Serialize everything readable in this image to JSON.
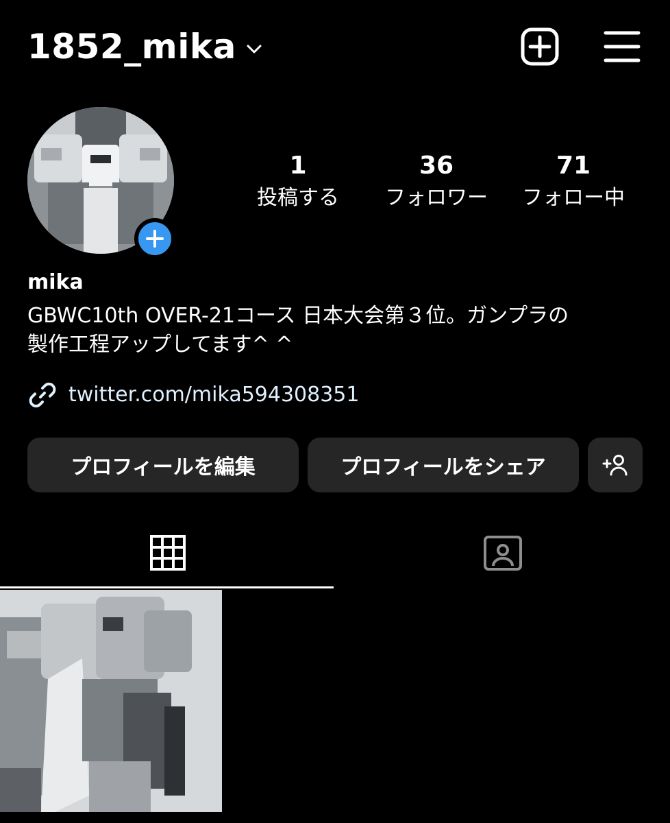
{
  "header": {
    "username": "1852_mika",
    "dropdown_icon": "chevron-down-icon",
    "new_post_icon": "plus-square-icon",
    "menu_icon": "hamburger-menu-icon"
  },
  "profile": {
    "avatar_icon": "profile-photo",
    "add_story_icon": "plus-icon",
    "stats": {
      "posts": {
        "value": "1",
        "label": "投稿する"
      },
      "followers": {
        "value": "36",
        "label": "フォロワー"
      },
      "following": {
        "value": "71",
        "label": "フォロー中"
      }
    },
    "name": "mika",
    "bio_lines": [
      "GBWC10th OVER-21コース 日本大会第３位。ガンプラの",
      "製作工程アップしてます^ ^"
    ],
    "link": {
      "icon": "link-icon",
      "text": "twitter.com/mika594308351"
    }
  },
  "actions": {
    "edit_label": "プロフィールを編集",
    "share_label": "プロフィールをシェア",
    "suggest_icon": "add-person-icon"
  },
  "tabs": [
    {
      "name": "grid",
      "icon": "grid-icon",
      "active": true
    },
    {
      "name": "tagged",
      "icon": "tagged-person-icon",
      "active": false
    }
  ],
  "posts": [
    {
      "icon": "post-photo"
    }
  ],
  "colors": {
    "background": "#000000",
    "button_bg": "#262626",
    "accent_blue": "#3897f0",
    "link_text": "#e0f1ff"
  }
}
